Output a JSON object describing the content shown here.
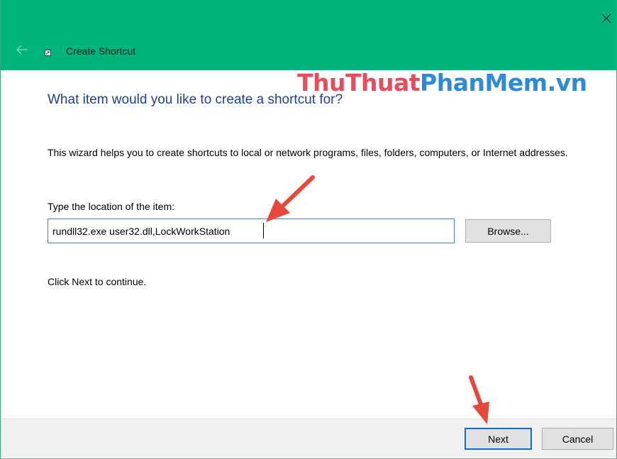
{
  "window": {
    "title": "Create Shortcut",
    "titlebar_color": "#00b47d"
  },
  "watermark": {
    "part1": "ThuThuat",
    "part2": "PhanMem.vn",
    "color1": "#e84b5c",
    "color2": "#2c8ad8"
  },
  "wizard": {
    "heading": "What item would you like to create a shortcut for?",
    "description": "This wizard helps you to create shortcuts to local or network programs, files, folders, computers, or Internet addresses.",
    "field_label": "Type the location of the item:",
    "location_value": "rundll32.exe user32.dll,LockWorkStation",
    "browse_label": "Browse...",
    "hint": "Click Next to continue."
  },
  "footer": {
    "next_label": "Next",
    "cancel_label": "Cancel"
  },
  "annotations": {
    "arrow_color": "#e8483c",
    "icons": [
      "back-arrow-icon",
      "shortcut-icon",
      "close-icon",
      "pointer-arrow-icon"
    ]
  }
}
